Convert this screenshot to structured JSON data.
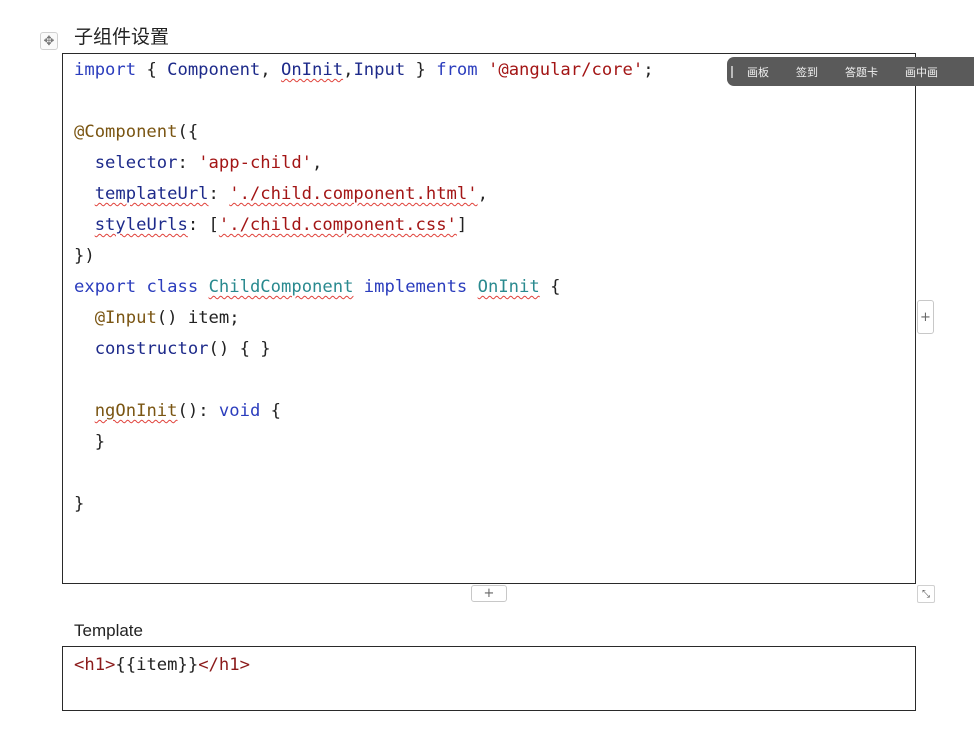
{
  "section": {
    "title": "子组件设置"
  },
  "toolbar": {
    "items": [
      "画板",
      "签到",
      "答题卡",
      "画中画"
    ]
  },
  "code": {
    "l1": {
      "import": "import",
      "brace_open": " { ",
      "component": "Component",
      "comma1": ", ",
      "oninit": "OnInit",
      "comma2": ",",
      "input": "Input",
      "brace_close": " } ",
      "from": "from",
      "space": " ",
      "path": "'@angular/core'",
      "semi": ";"
    },
    "l2": {
      "decorator": "@Component",
      "rest": "({"
    },
    "l3": {
      "key": "selector",
      "colon": ": ",
      "value": "'app-child'",
      "comma": ","
    },
    "l4": {
      "key": "templateUrl",
      "colon": ": ",
      "value": "'./child.component.html'",
      "comma": ","
    },
    "l5": {
      "key": "styleUrls",
      "colon": ": [",
      "value": "'./child.component.css'",
      "close": "]"
    },
    "l6": {
      "text": "})"
    },
    "l7": {
      "export": "export",
      "class": "class",
      "name": "ChildComponent",
      "implements": "implements",
      "iface": "OnInit",
      "brace": " {"
    },
    "l8": {
      "decorator": "@Input",
      "rest": "() item;"
    },
    "l9": {
      "ctor": "constructor",
      "rest": "() { }"
    },
    "l10": {
      "method": "ngOnInit",
      "rest": "(): ",
      "ret": "void",
      "brace": " {"
    },
    "l11": {
      "text": "}"
    },
    "l12": {
      "text": "}"
    }
  },
  "template": {
    "label": "Template",
    "open_tag": "<h1>",
    "binding": "{{item}}",
    "close_tag": "</h1>"
  },
  "controls": {
    "plus": "+",
    "move": "✥",
    "resize": "⤡"
  }
}
